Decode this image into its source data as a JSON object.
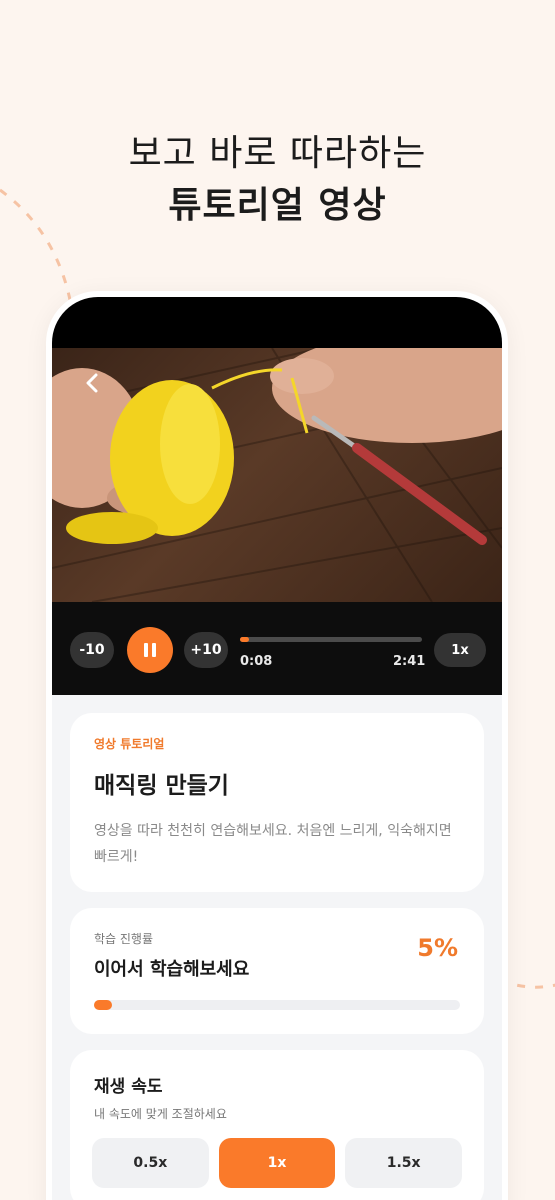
{
  "headline": {
    "line1": "보고 바로 따라하는",
    "line2": "튜토리얼 영상"
  },
  "player": {
    "skip_back": "-10",
    "skip_forward": "+10",
    "current_time": "0:08",
    "duration": "2:41",
    "progress": 0.05,
    "speed": "1x"
  },
  "tutorial": {
    "tag": "영상 튜토리얼",
    "title": "매직링 만들기",
    "description": "영상을 따라 천천히 연습해보세요. 처음엔 느리게, 익숙해지면 빠르게!"
  },
  "progress": {
    "label": "학습 진행률",
    "subtitle": "이어서 학습해보세요",
    "percent_text": "5%",
    "value": 0.05
  },
  "speed_settings": {
    "title": "재생 속도",
    "subtitle": "내 속도에 맞게 조절하세요",
    "options": [
      "0.5x",
      "1x",
      "1.5x"
    ],
    "selected": "1x"
  },
  "colors": {
    "accent": "#fa7a2a",
    "background": "#fdf5ef"
  },
  "icons": {
    "back": "chevron-left-icon",
    "pause": "pause-icon"
  }
}
